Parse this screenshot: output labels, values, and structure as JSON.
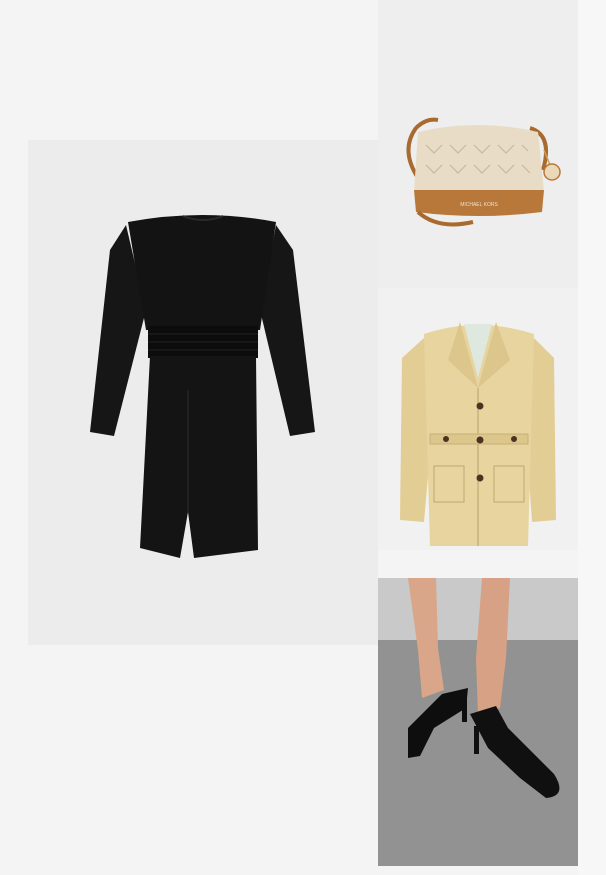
{
  "collage": {
    "items": [
      {
        "id": "dress",
        "name": "black-long-sleeve-dress"
      },
      {
        "id": "bag",
        "name": "monogram-shoulder-bag"
      },
      {
        "id": "blazer",
        "name": "beige-belted-blazer"
      },
      {
        "id": "shoes",
        "name": "black-kitten-heel-pumps"
      }
    ],
    "bag_brand_text": "MICHAEL KORS"
  },
  "colors": {
    "background": "#f4f4f4",
    "dress": "#111111",
    "bag_canvas": "#e8dcc6",
    "bag_leather": "#b8783a",
    "blazer": "#e6d29c",
    "shoes": "#0e0e0e",
    "floor": "#8f8f8f"
  }
}
